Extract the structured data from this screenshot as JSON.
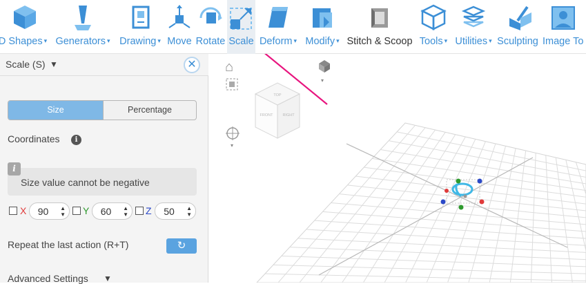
{
  "toolbar": {
    "items": [
      {
        "label": "D Shapes",
        "has_menu": true,
        "icon": "cube-icon"
      },
      {
        "label": "Generators",
        "has_menu": true,
        "icon": "generator-icon"
      },
      {
        "label": "Drawing",
        "has_menu": true,
        "icon": "drawing-icon"
      },
      {
        "label": "Move",
        "has_menu": false,
        "icon": "move-icon"
      },
      {
        "label": "Rotate",
        "has_menu": false,
        "icon": "rotate-icon"
      },
      {
        "label": "Scale",
        "has_menu": false,
        "icon": "scale-icon"
      },
      {
        "label": "Deform",
        "has_menu": true,
        "icon": "deform-icon"
      },
      {
        "label": "Modify",
        "has_menu": true,
        "icon": "modify-icon"
      },
      {
        "label": "Stitch & Scoop",
        "has_menu": false,
        "icon": "stitch-scoop-icon"
      },
      {
        "label": "Tools",
        "has_menu": true,
        "icon": "tools-icon"
      },
      {
        "label": "Utilities",
        "has_menu": true,
        "icon": "utilities-icon"
      },
      {
        "label": "Sculpting",
        "has_menu": false,
        "icon": "sculpting-icon"
      },
      {
        "label": "Image To",
        "has_menu": false,
        "icon": "image-to-icon"
      }
    ],
    "caret": "▾"
  },
  "panel": {
    "title": "Scale (S)",
    "title_caret": "▼",
    "close_glyph": "✕",
    "collapse_glyph": "‹",
    "tabs": {
      "size": "Size",
      "percentage": "Percentage"
    },
    "coordinates_label": "Coordinates",
    "info_glyph": "i",
    "note_badge": "i",
    "note_text": "Size value cannot be negative",
    "axes": [
      {
        "letter": "X",
        "value": "90",
        "color": "#e03a3a"
      },
      {
        "letter": "Y",
        "value": "60",
        "color": "#2e9a2e"
      },
      {
        "letter": "Z",
        "value": "50",
        "color": "#2b49c8"
      }
    ],
    "spin_arrows": "▲▼",
    "repeat_label": "Repeat the last action (R+T)",
    "repeat_glyph": "↻",
    "advanced_label": "Advanced Settings",
    "advanced_caret": "▼"
  },
  "viewport": {
    "home_glyph": "⌂",
    "view_caret": "▾",
    "cube_faces": {
      "top": "TOP",
      "front": "FRONT",
      "right": "RIGHT"
    }
  },
  "colors": {
    "accent": "#3c8fd6",
    "annotation_arrow": "#e8157f",
    "axis_x": "#e03a3a",
    "axis_y": "#2e9a2e",
    "axis_z": "#2b49c8"
  }
}
